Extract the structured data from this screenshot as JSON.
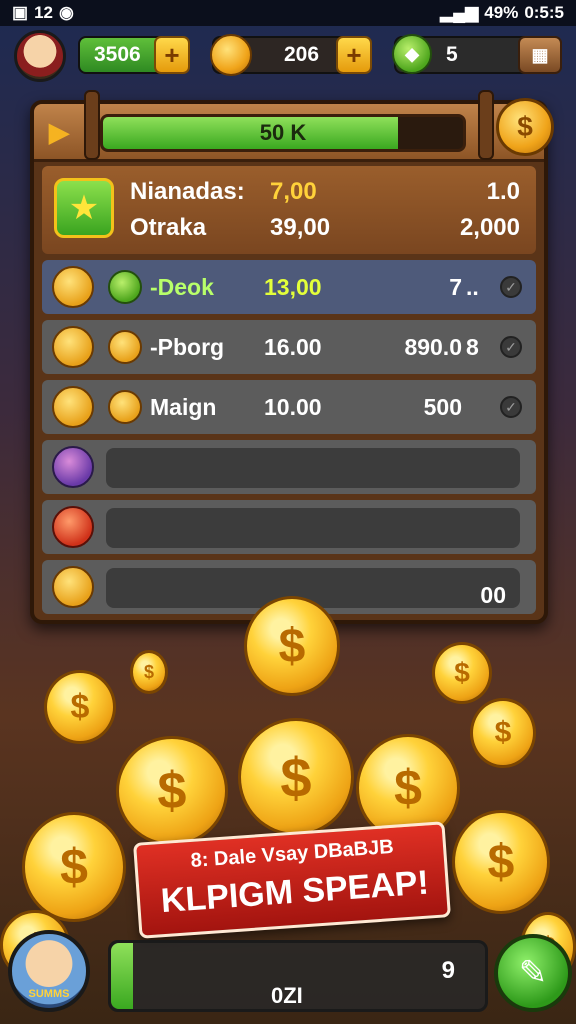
{
  "status_bar": {
    "left": "12",
    "battery": "49%",
    "time": "0:5:5"
  },
  "resources": {
    "gems": "3506",
    "coins": "206",
    "energy": "5"
  },
  "panel": {
    "progress_label": "50 K",
    "progress_fraction": 0.82,
    "summary": {
      "row1": {
        "label": "Nianadas:",
        "value": "7,00",
        "value2": "1.0"
      },
      "row2": {
        "label": "Otraka",
        "value": "39,00",
        "value2": "2,000"
      }
    },
    "rows": [
      {
        "name": "-Deok",
        "amount": "13,00",
        "qty": "7",
        "extra": "..",
        "highlight": true
      },
      {
        "name": "-Pborg",
        "amount": "16.00",
        "qty": "890.0",
        "extra": "8",
        "highlight": false
      },
      {
        "name": "Maign",
        "amount": "10.00",
        "qty": "500",
        "extra": "",
        "highlight": false
      }
    ],
    "empty_slot_value": "00"
  },
  "banner": {
    "line1": "8:  Dale Vsay DBaBJB",
    "line2": "KLPIGM SPEAP!"
  },
  "bottom": {
    "avatar_label": "SUMMS",
    "bar_value": "0ZI",
    "bar_number": "9"
  }
}
